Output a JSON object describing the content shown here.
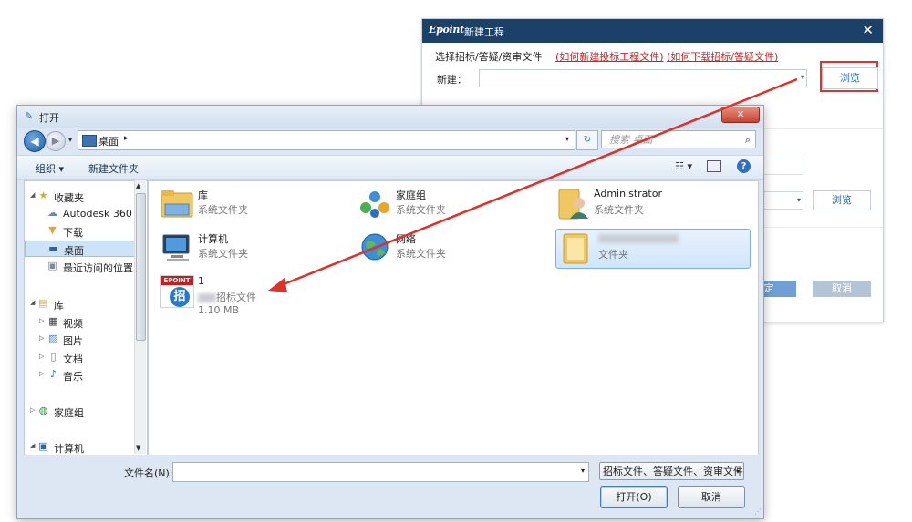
{
  "new_project": {
    "logo": "Epoint",
    "title": "新建工程",
    "close": "✕",
    "prompt": "选择招标/答疑/资审文件",
    "link_new": "(如何新建投标工程文件)",
    "link_download": "(如何下载招标/答疑文件)",
    "new_label": "新建：",
    "browse_label": "浏览",
    "browse2_label": "浏览",
    "confirm_label": "定",
    "cancel_label": "取消",
    "accent_color": "#1c4168",
    "link_color": "#d12222",
    "highlight_color": "#e03030"
  },
  "open_dialog": {
    "title": "打开",
    "close": "✕",
    "address_path": "桌面",
    "address_sep": "▸",
    "search_placeholder": "搜索 桌面",
    "toolbar": {
      "organize": "组织 ▾",
      "new_folder": "新建文件夹",
      "help": "?"
    },
    "nav": [
      {
        "label": "收藏夹",
        "icon": "star-icon",
        "expander": "◢"
      },
      {
        "label": "Autodesk 360",
        "icon": "cloud-icon",
        "expander": ""
      },
      {
        "label": "下载",
        "icon": "download-folder-icon",
        "expander": ""
      },
      {
        "label": "桌面",
        "icon": "desktop-icon",
        "expander": "",
        "selected": true
      },
      {
        "label": "最近访问的位置",
        "icon": "recent-places-icon",
        "expander": ""
      },
      {
        "label": "库",
        "icon": "library-icon",
        "expander": "◢"
      },
      {
        "label": "视频",
        "icon": "video-icon",
        "expander": "▷"
      },
      {
        "label": "图片",
        "icon": "picture-icon",
        "expander": "▷"
      },
      {
        "label": "文档",
        "icon": "document-icon",
        "expander": "▷"
      },
      {
        "label": "音乐",
        "icon": "music-icon",
        "expander": "▷"
      },
      {
        "label": "家庭组",
        "icon": "homegroup-icon",
        "expander": "▷"
      },
      {
        "label": "计算机",
        "icon": "computer-icon",
        "expander": "◢"
      }
    ],
    "files": [
      {
        "name": "库",
        "sub": "系统文件夹",
        "icon": "library-folder-icon"
      },
      {
        "name": "家庭组",
        "sub": "系统文件夹",
        "icon": "homegroup-icon"
      },
      {
        "name": "Administrator",
        "sub": "系统文件夹",
        "icon": "user-folder-icon"
      },
      {
        "name": "计算机",
        "sub": "系统文件夹",
        "icon": "computer-icon"
      },
      {
        "name": "网络",
        "sub": "系统文件夹",
        "icon": "network-globe-icon"
      },
      {
        "name": "",
        "sub": "文件夹",
        "icon": "folder-icon",
        "selected": true
      },
      {
        "name": "1",
        "sub": "招标文件",
        "size": "1.10 MB",
        "icon": "epoint-bid-file-icon",
        "icon_text": "EPOINT",
        "icon_char": "招"
      }
    ],
    "filename_label": "文件名(N):",
    "filename_value": "",
    "filter_label": "招标文件、答疑文件、资审文件",
    "open_label": "打开(O)",
    "cancel_label": "取消"
  }
}
